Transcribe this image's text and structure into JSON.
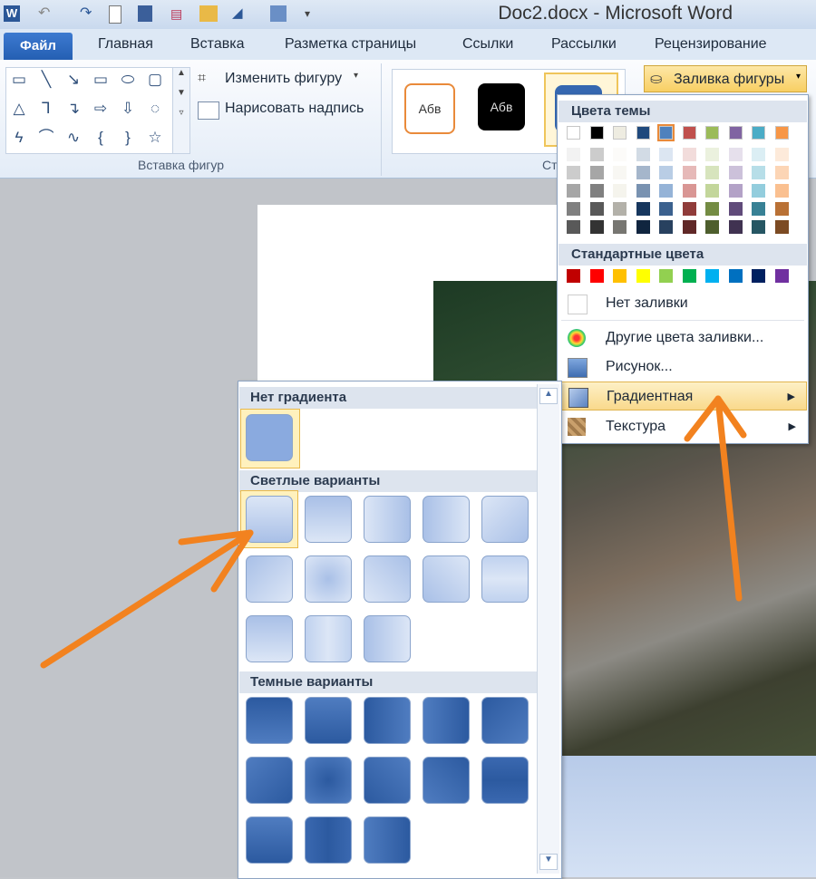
{
  "window": {
    "title": "Doc2.docx  -  Microsoft Word"
  },
  "tabs": {
    "file": "Файл",
    "items": [
      "Главная",
      "Вставка",
      "Разметка страницы",
      "Ссылки",
      "Рассылки",
      "Рецензирование"
    ]
  },
  "ribbon": {
    "insert_shapes_label": "Вставка фигур",
    "change_shape": "Изменить фигуру",
    "draw_textbox": "Нарисовать надпись",
    "styles_label_partial": "Ст",
    "style_sample": "Абв",
    "shape_fill": "Заливка фигуры"
  },
  "fill_menu": {
    "theme_colors": "Цвета темы",
    "standard_colors": "Стандартные цвета",
    "no_fill": "Нет заливки",
    "more_colors": "Другие цвета заливки...",
    "picture": "Рисунок...",
    "gradient": "Градиентная",
    "texture": "Текстура",
    "theme_row": [
      "#ffffff",
      "#000000",
      "#eeece1",
      "#1f497d",
      "#4f81bd",
      "#c0504d",
      "#9bbb59",
      "#8064a2",
      "#4bacc6",
      "#f79646"
    ],
    "standard_row": [
      "#c00000",
      "#ff0000",
      "#ffc000",
      "#ffff00",
      "#92d050",
      "#00b050",
      "#00b0f0",
      "#0070c0",
      "#002060",
      "#7030a0"
    ]
  },
  "gradient_panel": {
    "no_gradient": "Нет градиента",
    "light": "Светлые варианты",
    "dark": "Темные варианты"
  }
}
